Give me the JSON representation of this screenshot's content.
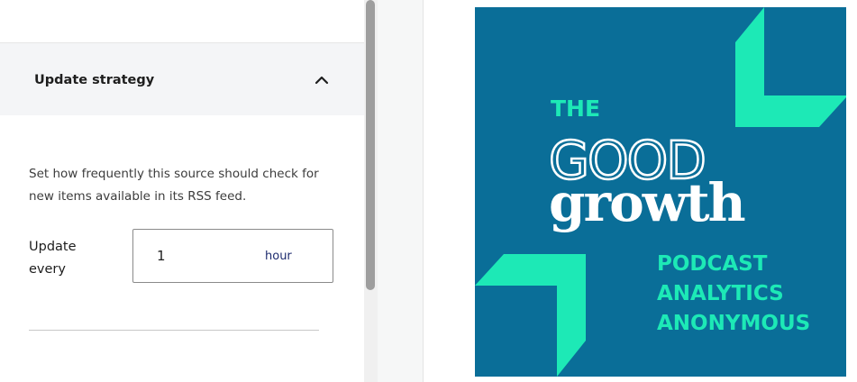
{
  "section": {
    "title": "Update strategy",
    "toggle_icon": "chevron-up-icon"
  },
  "description": "Set how frequently this source should check for new items available in its RSS feed.",
  "update_every": {
    "label": "Update every",
    "value": "1",
    "unit": "hour"
  },
  "podcast_cover": {
    "line1": "THE",
    "line2": "GOOD",
    "line3": "growth",
    "line4": "PODCAST",
    "line5": "ANALYTICS",
    "line6": "ANONYMOUS",
    "colors": {
      "background": "#0a6e98",
      "accent": "#1de9b6",
      "text": "#ffffff"
    }
  }
}
